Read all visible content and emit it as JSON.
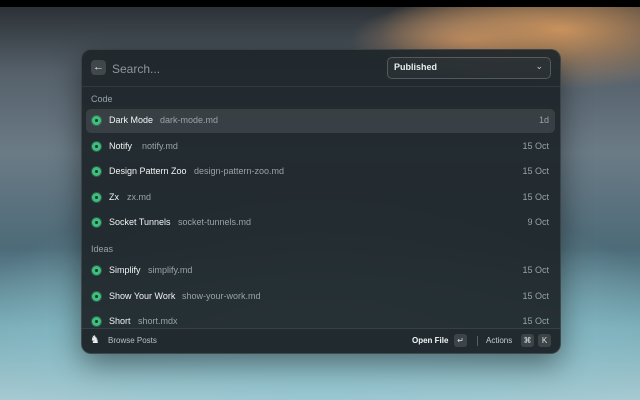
{
  "search": {
    "placeholder": "Search..."
  },
  "filter": {
    "selected": "Published"
  },
  "icons": {
    "back": "arrow-left-icon",
    "dropdown": "chevron-down-icon",
    "status": "published-status-icon",
    "footer": "raycast-extension-icon",
    "enter": "enter-key-icon"
  },
  "colors": {
    "status_green": "#3fbf7f"
  },
  "sections": [
    {
      "label": "Code",
      "items": [
        {
          "title": "Dark Mode",
          "file": "dark-mode.md",
          "date": "1d"
        },
        {
          "title": "Notify",
          "file": "notify.md",
          "date": "15 Oct"
        },
        {
          "title": "Design Pattern Zoo",
          "file": "design-pattern-zoo.md",
          "date": "15 Oct"
        },
        {
          "title": "Zx",
          "file": "zx.md",
          "date": "15 Oct"
        },
        {
          "title": "Socket Tunnels",
          "file": "socket-tunnels.md",
          "date": "9 Oct"
        }
      ]
    },
    {
      "label": "Ideas",
      "items": [
        {
          "title": "Simplify",
          "file": "simplify.md",
          "date": "15 Oct"
        },
        {
          "title": "Show Your Work",
          "file": "show-your-work.md",
          "date": "15 Oct"
        },
        {
          "title": "Short",
          "file": "short.mdx",
          "date": "15 Oct"
        }
      ]
    }
  ],
  "footer": {
    "command": "Browse Posts",
    "primary_action": "Open File",
    "enter_key": "↵",
    "actions": "Actions",
    "cmd_key": "⌘",
    "k_key": "K"
  }
}
